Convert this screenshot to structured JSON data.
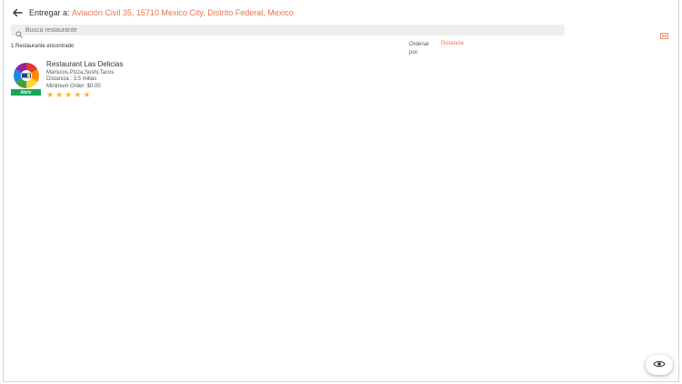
{
  "header": {
    "deliver_label": "Entregar a:",
    "address": "Aviación Civil 35, 15710 Mexico City, Distrito Federal, Mexico"
  },
  "search": {
    "placeholder": "Busca restaurante"
  },
  "results": {
    "count_text": "1 Restaurante encontrado",
    "sort_label": "Ordenar por:",
    "sort_value": "Distancia"
  },
  "restaurants": [
    {
      "name": "Restaurant Las Delicias",
      "cuisine": "Mariscos,Pizza,Sushi,Tacos",
      "distance": "Distancia : 3.5 millas",
      "minimum_order": "Minimum Order: $0.00",
      "status": "Abrir",
      "rating": 5
    }
  ],
  "icons": {
    "back": "arrow-left-icon",
    "search": "search-icon",
    "map_toggle": "map-toggle-icon",
    "fab": "eye-icon",
    "star": "star-icon"
  },
  "colors": {
    "accent": "#e8744f",
    "open_badge": "#1aa45a",
    "star": "#f5b53a"
  }
}
